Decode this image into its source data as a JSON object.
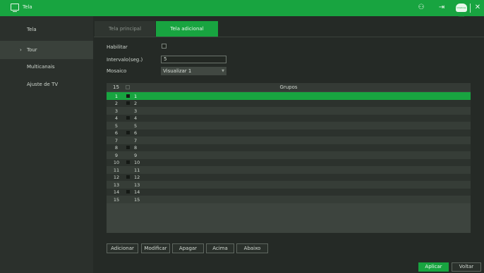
{
  "window": {
    "title": "Tela"
  },
  "topbar_icons": [
    "user-settings-icon",
    "logout-icon",
    "cloud-icon",
    "close-icon"
  ],
  "cloud_badge": "Intelbras Cloud",
  "sidebar": {
    "items": [
      {
        "label": "Tela",
        "chevron": ""
      },
      {
        "label": "Tour",
        "chevron": "›"
      },
      {
        "label": "Multicanais",
        "chevron": ""
      },
      {
        "label": "Ajuste de TV",
        "chevron": ""
      }
    ],
    "active_index": 1
  },
  "tabs": [
    {
      "label": "Tela principal"
    },
    {
      "label": "Tela adicional"
    }
  ],
  "active_tab": 1,
  "form": {
    "enable_label": "Habilitar",
    "enable_checked": false,
    "interval_label": "Intervalo(seg.)",
    "interval_value": "5",
    "mosaic_label": "Mosaico",
    "mosaic_value": "Visualizar 1"
  },
  "table": {
    "count": "15",
    "header": "Grupos",
    "rows": [
      {
        "num": "1",
        "group": "1",
        "checked": true,
        "selected": true
      },
      {
        "num": "2",
        "group": "2",
        "checked": true
      },
      {
        "num": "3",
        "group": "3",
        "checked": false
      },
      {
        "num": "4",
        "group": "4",
        "checked": true
      },
      {
        "num": "5",
        "group": "5",
        "checked": false
      },
      {
        "num": "6",
        "group": "6",
        "checked": true
      },
      {
        "num": "7",
        "group": "7",
        "checked": false
      },
      {
        "num": "8",
        "group": "8",
        "checked": true
      },
      {
        "num": "9",
        "group": "9",
        "checked": false
      },
      {
        "num": "10",
        "group": "10",
        "checked": true
      },
      {
        "num": "11",
        "group": "11",
        "checked": false
      },
      {
        "num": "12",
        "group": "12",
        "checked": true
      },
      {
        "num": "13",
        "group": "13",
        "checked": false
      },
      {
        "num": "14",
        "group": "14",
        "checked": true
      },
      {
        "num": "15",
        "group": "15",
        "checked": false
      }
    ]
  },
  "buttons": {
    "add": "Adicionar",
    "modify": "Modificar",
    "delete": "Apagar",
    "up": "Acima",
    "down": "Abaixo",
    "apply": "Aplicar",
    "back": "Voltar"
  },
  "colors": {
    "accent": "#18a440",
    "background": "#252a26",
    "sidebar": "#2b302c"
  }
}
